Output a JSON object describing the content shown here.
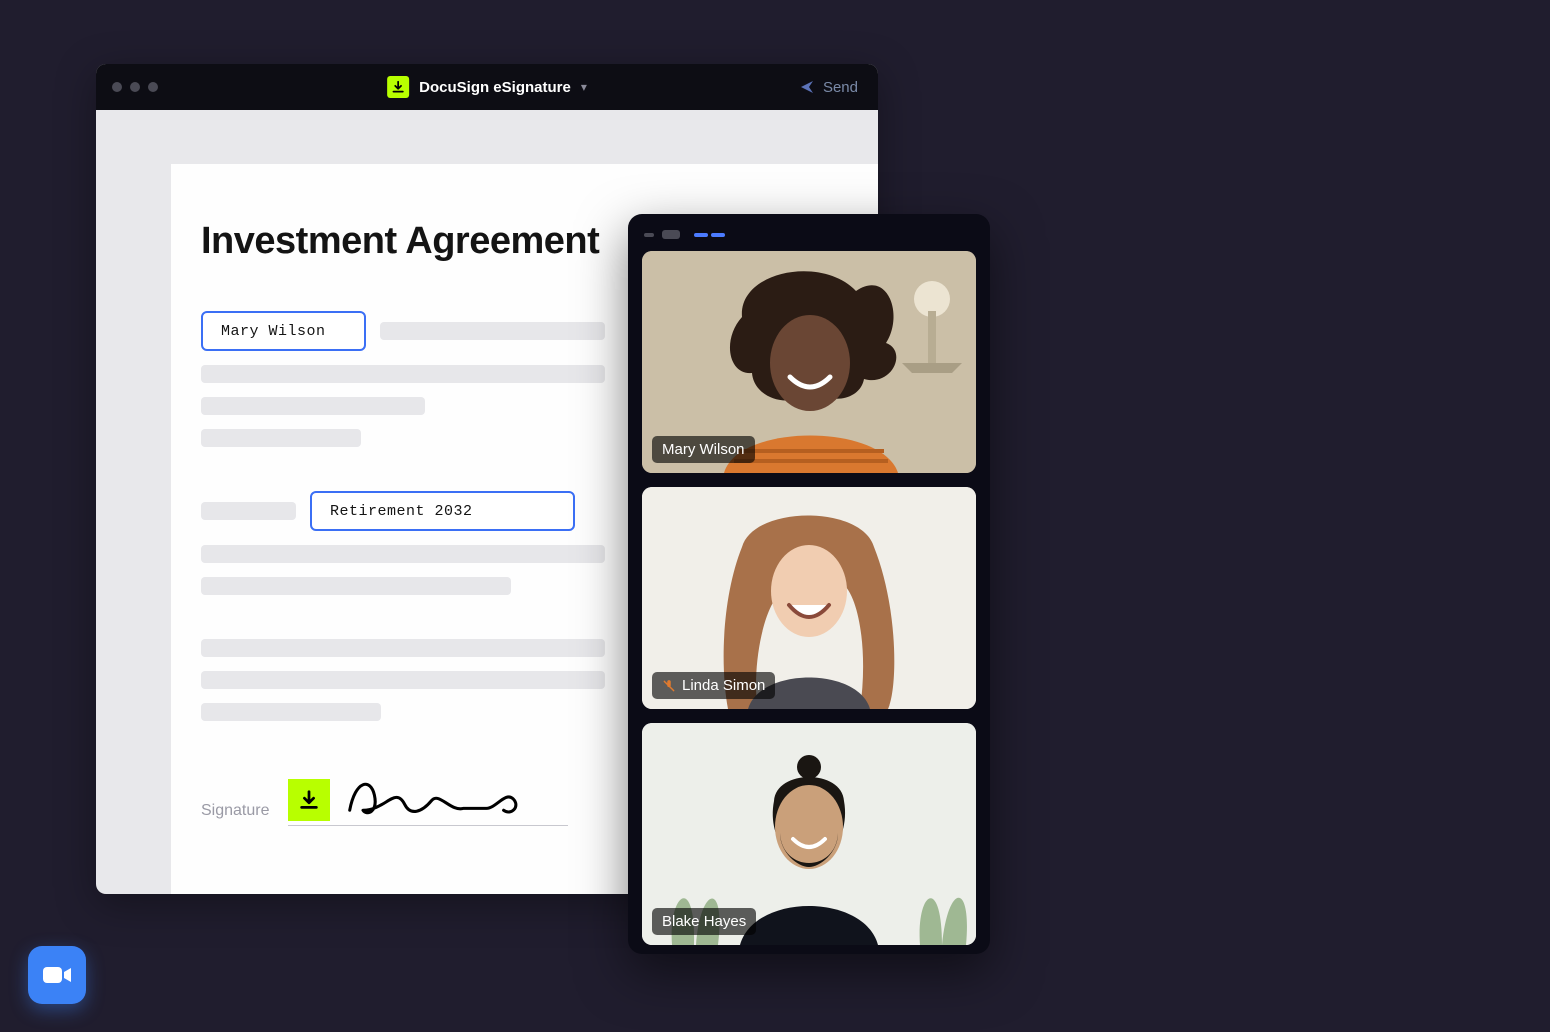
{
  "app": {
    "name": "DocuSign eSignature",
    "send_label": "Send"
  },
  "document": {
    "title": "Investment Agreement",
    "field_name_value": "Mary Wilson",
    "field_plan_value": "Retirement 2032",
    "signature_label": "Signature"
  },
  "call": {
    "participants": [
      {
        "name": "Mary Wilson",
        "muted": false
      },
      {
        "name": "Linda Simon",
        "muted": true
      },
      {
        "name": "Blake Hayes",
        "muted": false
      }
    ]
  }
}
